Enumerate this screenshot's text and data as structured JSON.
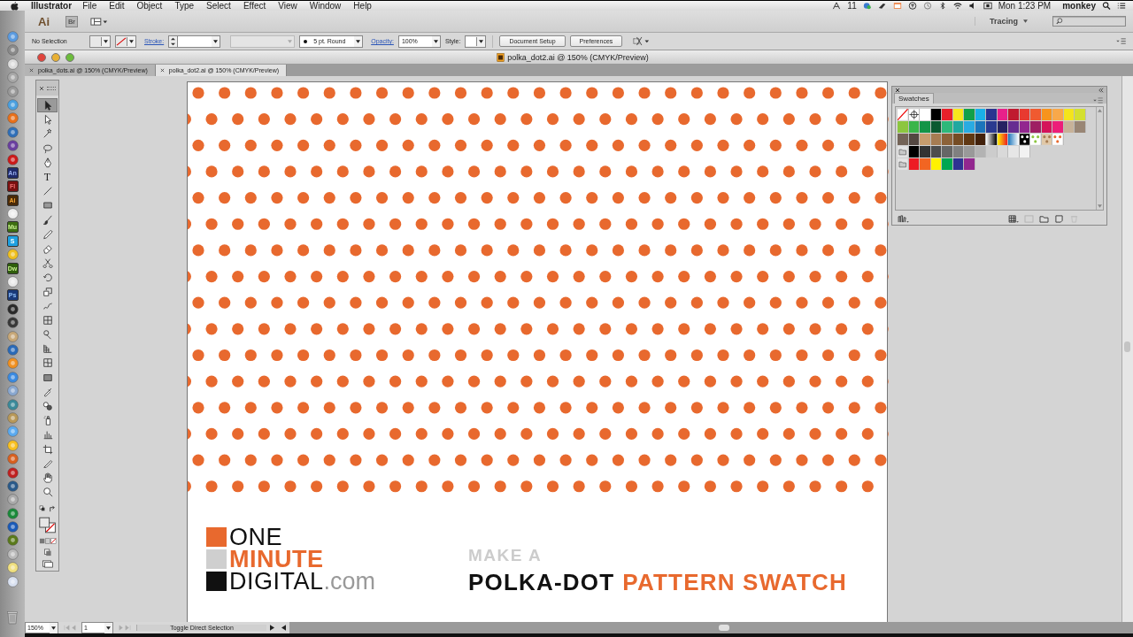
{
  "menubar": {
    "app": "Illustrator",
    "menus": [
      "File",
      "Edit",
      "Object",
      "Type",
      "Select",
      "Effect",
      "View",
      "Window",
      "Help"
    ],
    "status_number": "11",
    "clock": "Mon 1:23 PM",
    "user": "monkey"
  },
  "dock": [
    {
      "kind": "icon"
    },
    {
      "kind": "icon"
    },
    {
      "kind": "icon"
    },
    {
      "kind": "icon"
    },
    {
      "kind": "icon"
    },
    {
      "kind": "icon"
    },
    {
      "kind": "icon"
    },
    {
      "kind": "icon"
    },
    {
      "kind": "icon"
    },
    {
      "kind": "icon"
    },
    {
      "kind": "badge",
      "label": "An"
    },
    {
      "kind": "badge",
      "label": "Fl"
    },
    {
      "kind": "badge",
      "label": "Ai"
    },
    {
      "kind": "icon"
    },
    {
      "kind": "badge",
      "label": "Mu"
    },
    {
      "kind": "badge",
      "label": "S"
    },
    {
      "kind": "icon"
    },
    {
      "kind": "badge",
      "label": "Dw"
    },
    {
      "kind": "icon"
    },
    {
      "kind": "badge",
      "label": "Ps"
    },
    {
      "kind": "icon"
    },
    {
      "kind": "icon"
    },
    {
      "kind": "icon"
    },
    {
      "kind": "icon"
    },
    {
      "kind": "icon"
    },
    {
      "kind": "icon"
    },
    {
      "kind": "icon"
    },
    {
      "kind": "icon"
    },
    {
      "kind": "icon"
    },
    {
      "kind": "icon"
    },
    {
      "kind": "icon"
    },
    {
      "kind": "icon"
    },
    {
      "kind": "icon"
    },
    {
      "kind": "icon"
    },
    {
      "kind": "icon"
    },
    {
      "kind": "icon"
    },
    {
      "kind": "icon"
    },
    {
      "kind": "icon"
    },
    {
      "kind": "icon"
    },
    {
      "kind": "icon"
    },
    {
      "kind": "icon"
    }
  ],
  "app_bar": {
    "logo": "Ai",
    "bridge": "Br",
    "workspace": "Tracing"
  },
  "control_bar": {
    "selection": "No Selection",
    "stroke_label": "Stroke:",
    "brush": "5 pt. Round",
    "opacity_label": "Opacity:",
    "opacity": "100%",
    "style_label": "Style:",
    "buttons": [
      "Document Setup",
      "Preferences"
    ]
  },
  "document": {
    "title": "polka_dot2.ai @ 150% (CMYK/Preview)",
    "tabs": [
      {
        "label": "polka_dots.ai @ 150% (CMYK/Preview)",
        "selected": false
      },
      {
        "label": "polka_dot2.ai @ 150% (CMYK/Preview)",
        "selected": true
      }
    ]
  },
  "tools": [
    {
      "kind": "selection",
      "selected": true
    },
    {
      "kind": "direct-selection",
      "selected": false
    },
    {
      "kind": "magic-wand",
      "selected": false
    },
    {
      "kind": "lasso",
      "selected": false
    },
    {
      "kind": "pen",
      "selected": false
    },
    {
      "kind": "type",
      "label": "T",
      "selected": false
    },
    {
      "kind": "line",
      "selected": false
    },
    {
      "kind": "rectangle",
      "selected": false
    },
    {
      "kind": "paintbrush",
      "selected": false
    },
    {
      "kind": "pencil",
      "selected": false
    },
    {
      "kind": "eraser",
      "selected": false
    },
    {
      "kind": "scissors",
      "selected": false
    },
    {
      "kind": "rotate",
      "selected": false
    },
    {
      "kind": "scale",
      "selected": false
    },
    {
      "kind": "warp",
      "selected": false
    },
    {
      "kind": "free-transform",
      "selected": false
    },
    {
      "kind": "shape-builder",
      "selected": false
    },
    {
      "kind": "perspective-grid",
      "selected": false
    },
    {
      "kind": "mesh",
      "selected": false
    },
    {
      "kind": "gradient",
      "selected": false
    },
    {
      "kind": "eyedropper",
      "selected": false
    },
    {
      "kind": "blend",
      "selected": false
    },
    {
      "kind": "symbol-sprayer",
      "selected": false
    },
    {
      "kind": "column-graph",
      "selected": false
    },
    {
      "kind": "artboard",
      "selected": false
    },
    {
      "kind": "slice",
      "selected": false
    },
    {
      "kind": "hand",
      "selected": false
    },
    {
      "kind": "zoom",
      "selected": false
    }
  ],
  "artboard": {
    "logo": [
      "ONE",
      "MINUTE",
      "DIGITAL"
    ],
    "logo_suffix": ".com",
    "kicker": "MAKE A",
    "headline": "POLKA-DOT",
    "headline_accent": "PATTERN SWATCH"
  },
  "swatches_panel": {
    "tab": "Swatches",
    "rows": [
      [
        {
          "kind": "none"
        },
        {
          "kind": "registration"
        },
        {
          "kind": "color",
          "color": "#ffffff"
        },
        {
          "kind": "color",
          "color": "#000000"
        },
        {
          "kind": "color",
          "color": "#e8202a"
        },
        {
          "kind": "color",
          "color": "#f8e71c"
        },
        {
          "kind": "color",
          "color": "#12a04a"
        },
        {
          "kind": "color",
          "color": "#1ab0e8"
        },
        {
          "kind": "color",
          "color": "#2a3590"
        },
        {
          "kind": "color",
          "color": "#e8208a"
        },
        {
          "kind": "color",
          "color": "#c01a30"
        },
        {
          "kind": "color",
          "color": "#e83a30"
        },
        {
          "kind": "color",
          "color": "#f05a30"
        },
        {
          "kind": "color",
          "color": "#f7941d"
        },
        {
          "kind": "color",
          "color": "#f8a84a"
        },
        {
          "kind": "color",
          "color": "#f4e41c"
        },
        {
          "kind": "color",
          "color": "#d4e030"
        }
      ],
      [
        {
          "kind": "color",
          "color": "#8cc63f"
        },
        {
          "kind": "color",
          "color": "#39b54a"
        },
        {
          "kind": "color",
          "color": "#139447"
        },
        {
          "kind": "color",
          "color": "#0a5a30"
        },
        {
          "kind": "color",
          "color": "#2eb87a"
        },
        {
          "kind": "color",
          "color": "#20a8a0"
        },
        {
          "kind": "color",
          "color": "#29abe2"
        },
        {
          "kind": "color",
          "color": "#1b75bb"
        },
        {
          "kind": "color",
          "color": "#2a3a90"
        },
        {
          "kind": "color",
          "color": "#262262"
        },
        {
          "kind": "color",
          "color": "#662d91"
        },
        {
          "kind": "color",
          "color": "#92278f"
        },
        {
          "kind": "color",
          "color": "#9e1f63"
        },
        {
          "kind": "color",
          "color": "#d4145a"
        },
        {
          "kind": "color",
          "color": "#ed1e79"
        },
        {
          "kind": "color",
          "color": "#c7b299"
        },
        {
          "kind": "color",
          "color": "#998675"
        }
      ],
      [
        {
          "kind": "color",
          "color": "#736357"
        },
        {
          "kind": "color",
          "color": "#534741"
        },
        {
          "kind": "color",
          "color": "#c69c6d"
        },
        {
          "kind": "color",
          "color": "#a67c52"
        },
        {
          "kind": "color",
          "color": "#8c6239"
        },
        {
          "kind": "color",
          "color": "#754c24"
        },
        {
          "kind": "color",
          "color": "#603813"
        },
        {
          "kind": "color",
          "color": "#42210b"
        },
        {
          "kind": "gradient"
        },
        {
          "kind": "gradient"
        },
        {
          "kind": "gradient"
        },
        {
          "kind": "pattern"
        },
        {
          "kind": "pattern"
        },
        {
          "kind": "pattern"
        },
        {
          "kind": "pattern"
        }
      ],
      [
        {
          "kind": "folder"
        },
        {
          "kind": "color",
          "color": "#000000"
        },
        {
          "kind": "color",
          "color": "#333333"
        },
        {
          "kind": "color",
          "color": "#4d4d4d"
        },
        {
          "kind": "color",
          "color": "#666666"
        },
        {
          "kind": "color",
          "color": "#808080"
        },
        {
          "kind": "color",
          "color": "#999999"
        },
        {
          "kind": "color",
          "color": "#b3b3b3"
        },
        {
          "kind": "color",
          "color": "#cccccc"
        },
        {
          "kind": "color",
          "color": "#d9d9d9"
        },
        {
          "kind": "color",
          "color": "#e6e6e6"
        },
        {
          "kind": "color",
          "color": "#f2f2f2"
        }
      ],
      [
        {
          "kind": "folder"
        },
        {
          "kind": "color",
          "color": "#ed1c24"
        },
        {
          "kind": "color",
          "color": "#f26522"
        },
        {
          "kind": "color",
          "color": "#fff200"
        },
        {
          "kind": "color",
          "color": "#00a651"
        },
        {
          "kind": "color",
          "color": "#2e3192"
        },
        {
          "kind": "color",
          "color": "#92278f"
        }
      ]
    ]
  },
  "status_bar": {
    "zoom": "150%",
    "page": "1",
    "message": "Toggle Direct Selection"
  }
}
